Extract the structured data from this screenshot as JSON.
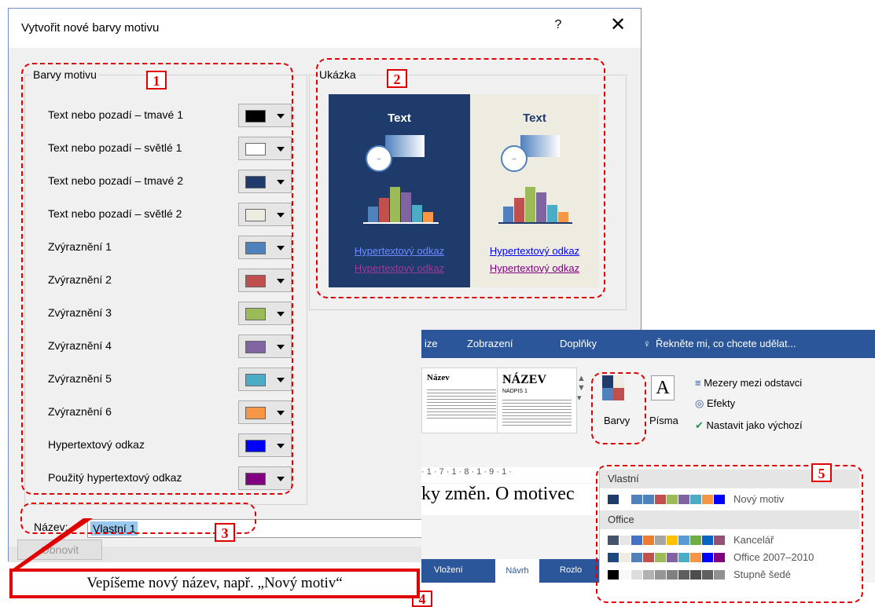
{
  "dialog": {
    "title": "Vytvořit nové barvy motivu",
    "help_label": "?",
    "close_label": "✕",
    "group_colors_label": "Barvy motivu",
    "group_preview_label": "Ukázka",
    "rows": [
      {
        "label": "Text nebo pozadí – tmavé 1",
        "color": "#000000"
      },
      {
        "label": "Text nebo pozadí – světlé 1",
        "color": "#ffffff"
      },
      {
        "label": "Text nebo pozadí – tmavé 2",
        "color": "#1f3b6b"
      },
      {
        "label": "Text nebo pozadí – světlé 2",
        "color": "#eeece1"
      },
      {
        "label": "Zvýraznění 1",
        "color": "#4f81bd"
      },
      {
        "label": "Zvýraznění 2",
        "color": "#c0504d"
      },
      {
        "label": "Zvýraznění 3",
        "color": "#9bbb59"
      },
      {
        "label": "Zvýraznění 4",
        "color": "#8064a2"
      },
      {
        "label": "Zvýraznění 5",
        "color": "#4bacc6"
      },
      {
        "label": "Zvýraznění 6",
        "color": "#f79646"
      },
      {
        "label": "Hypertextový odkaz",
        "color": "#0000ff"
      },
      {
        "label": "Použitý hypertextový odkaz",
        "color": "#800080"
      }
    ],
    "preview": {
      "text_label": "Text",
      "hyperlink_label": "Hypertextový odkaz",
      "followed_label": "Hypertextový odkaz",
      "bars": [
        {
          "color": "#4f81bd",
          "value": 0.45
        },
        {
          "color": "#c0504d",
          "value": 0.7
        },
        {
          "color": "#9bbb59",
          "value": 1.0
        },
        {
          "color": "#8064a2",
          "value": 0.85
        },
        {
          "color": "#4bacc6",
          "value": 0.5
        },
        {
          "color": "#f79646",
          "value": 0.3
        }
      ]
    },
    "name_label": "Název:",
    "name_value": "Vlastní 1",
    "reset_button": "Obnovit"
  },
  "annotations": {
    "n1": "1",
    "n2": "2",
    "n3": "3",
    "n4": "4",
    "n5": "5",
    "callout": "Vepíšeme nový název, např. „Nový motiv“"
  },
  "ribbon": {
    "tabs": [
      "ize",
      "Zobrazení",
      "Doplňky",
      "Řekněte mi, co chcete udělat..."
    ],
    "style1_title": "Název",
    "style2_title": "NÁZEV",
    "style2_sub": "NADPIS 1",
    "colors_button": "Barvy",
    "fonts_button": "Písma",
    "spacing": "Mezery mezi odstavci",
    "effects": "Efekty",
    "set_default": "Nastavit jako výchozí",
    "ruler": "· 1 · 7 · 1 · 8 · 1 · 9 · 1 ·",
    "body_text": "ky změn. O motivec",
    "bottom_tabs": [
      "Vložení",
      "Návrh",
      "Rozlo"
    ],
    "menu": {
      "custom_header": "Vlastní",
      "office_header": "Office",
      "items": [
        {
          "label": "Nový motiv",
          "colors": [
            "#1f3b6b",
            "#ffffff",
            "#4f81bd",
            "#4f81bd",
            "#c0504d",
            "#9bbb59",
            "#8064a2",
            "#4bacc6",
            "#f79646",
            "#0000ff"
          ]
        },
        {
          "label": "Kancelář",
          "colors": [
            "#44546a",
            "#e7e6e6",
            "#4472c4",
            "#ed7d31",
            "#a5a5a5",
            "#ffc000",
            "#5b9bd5",
            "#70ad47",
            "#0563c1",
            "#954f72"
          ]
        },
        {
          "label": "Office 2007–2010",
          "colors": [
            "#1f497d",
            "#eeece1",
            "#4f81bd",
            "#c0504d",
            "#9bbb59",
            "#8064a2",
            "#4bacc6",
            "#f79646",
            "#0000ff",
            "#800080"
          ]
        },
        {
          "label": "Stupně šedé",
          "colors": [
            "#000000",
            "#f8f8f8",
            "#dddddd",
            "#b2b2b2",
            "#969696",
            "#808080",
            "#5f5f5f",
            "#4d4d4d",
            "#5f5f5f",
            "#919191"
          ]
        }
      ]
    }
  }
}
